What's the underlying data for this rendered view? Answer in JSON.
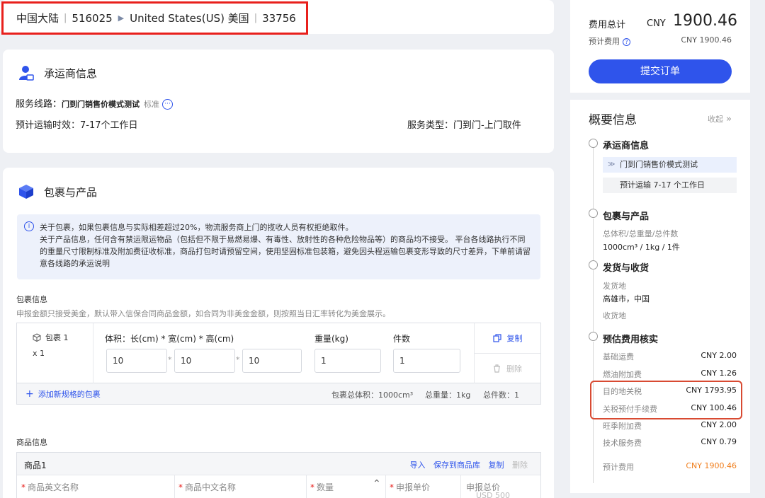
{
  "route": {
    "origin": "中国大陆",
    "origin_zip": "516025",
    "destination": "United States(US) 美国",
    "destination_zip": "33756"
  },
  "carrier": {
    "title": "承运商信息",
    "line_label": "服务线路：",
    "line_value": "门到门销售价模式测试",
    "line_tag": "标准",
    "eta_label": "预计运输时效：",
    "eta_value": "7-17个工作日",
    "service_label": "服务类型：",
    "service_value": "门到门-上门取件"
  },
  "package": {
    "title": "包裹与产品",
    "notice_line1": "关于包裹，如果包裹信息与实际相差超过20%，物流服务商上门的揽收人员有权拒绝取件。",
    "notice_line2": "关于产品信息，任何含有禁运限运物品（包括但不限于易燃易爆、有毒性、放射性的各种危险物品等）的商品均不接受。 平台各线路执行不同的重量尺寸限制标准及附加费征收标准，商品打包时请预留空间，使用坚固标准包装箱，避免因头程运输包裹变形导致的尺寸差异，下单前请留意各线路的承运说明",
    "info_label": "包裹信息",
    "info_hint": "申报金额只接受美金，默认带入信保合同商品金额，如合同为非美金金额，则按照当日汇率转化为美金展示。",
    "pkg_name": "包裹 1",
    "pkg_count": "x 1",
    "volume_label": "体积：长(cm) * 宽(cm) * 高(cm)",
    "length": "10",
    "width": "10",
    "height": "10",
    "weight_label": "重量(kg)",
    "weight": "1",
    "qty_label": "件数",
    "qty": "1",
    "copy_label": "复制",
    "delete_label": "删除",
    "add_label": "添加新规格的包裹",
    "total_volume": "包裹总体积：1000cm³",
    "total_weight": "总重量：1kg",
    "total_count": "总件数：1"
  },
  "goods": {
    "label": "商品信息",
    "item_name": "商品1",
    "import": "导入",
    "save": "保存到商品库",
    "copy": "复制",
    "delete": "删除",
    "col_en": "商品英文名称",
    "col_cn": "商品中文名称",
    "col_qty": "数量",
    "col_price": "申报单价",
    "col_total": "申报总价",
    "total_value": "USD 500"
  },
  "summary_top": {
    "total_label": "费用总计",
    "currency": "CNY",
    "total_value": "1900.46",
    "est_label": "预计费用",
    "est_value": "CNY 1900.46",
    "submit": "提交订单"
  },
  "summary": {
    "title": "概要信息",
    "collapse": "收起",
    "carrier_head": "承运商信息",
    "carrier_line": "门到门销售价模式测试",
    "carrier_eta": "预计运输 7-17 个工作日",
    "pkg_head": "包裹与产品",
    "pkg_sub": "总体积/总重量/总件数",
    "pkg_val": "1000cm³ / 1kg / 1件",
    "ship_head": "发货与收货",
    "from_label": "发货地",
    "from_val": "高雄市，中国",
    "to_label": "收货地",
    "fee_head": "预估费用核实",
    "fees": [
      {
        "label": "基础运费",
        "amount": "CNY 2.00"
      },
      {
        "label": "燃油附加费",
        "amount": "CNY 1.26"
      },
      {
        "label": "目的地关税",
        "amount": "CNY 1793.95"
      },
      {
        "label": "关税预付手续费",
        "amount": "CNY 100.46"
      },
      {
        "label": "旺季附加费",
        "amount": "CNY 2.00"
      },
      {
        "label": "技术服务费",
        "amount": "CNY 0.79"
      }
    ],
    "est_label": "预计费用",
    "est_value": "CNY 1900.46"
  },
  "colors": {
    "primary": "#2f54eb",
    "highlight": "#e8201c",
    "estimate": "#f07d1a"
  }
}
